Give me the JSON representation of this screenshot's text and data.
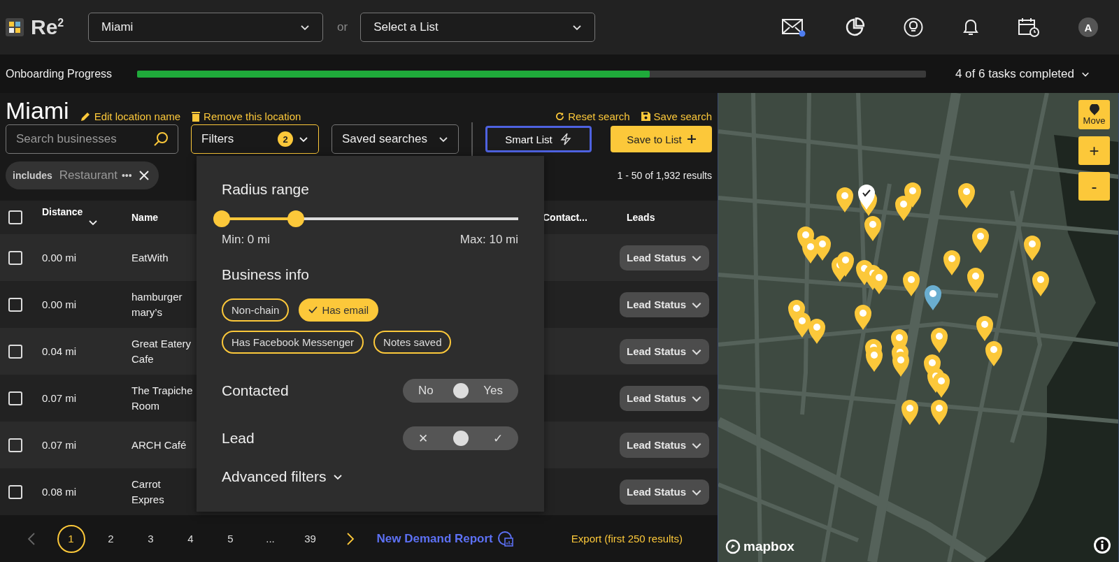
{
  "header": {
    "logo": "Re$^{2}$",
    "location_select": {
      "value": "Miami"
    },
    "separator": "or",
    "list_select": {
      "placeholder": "Select a List"
    },
    "mail_unread": true,
    "avatar": "A"
  },
  "onboarding": {
    "label": "Onboarding Progress",
    "level": 0.65,
    "summary": "4 of 6 tasks completed"
  },
  "location": {
    "title": "Miami",
    "actions": [
      {
        "kind": "edit",
        "label": "Edit location name"
      },
      {
        "kind": "remove",
        "label": "Remove this location"
      }
    ],
    "search_actions": [
      {
        "kind": "reset",
        "label": "Reset search"
      },
      {
        "kind": "save",
        "label": "Save search"
      }
    ]
  },
  "search": {
    "placeholder": "Search businesses"
  },
  "filters_button": {
    "label": "Filters",
    "count": "2",
    "expanded": true
  },
  "saved_searches": {
    "label": "Saved searches"
  },
  "smart_list_button": {
    "label": "Smart List"
  },
  "save_to_list_button": {
    "label": "Save to List"
  },
  "chips": [
    {
      "prefix": "includes",
      "value": "Restaurant",
      "more": "•••"
    }
  ],
  "results_count": "1 - 50 of 1,932 results",
  "table": {
    "all_selected": false,
    "columns": [
      {
        "label": "Distance",
        "sorted": true
      },
      {
        "label": "Name"
      },
      {
        "label": "Contact..."
      },
      {
        "label": "Leads"
      }
    ],
    "rows": [
      {
        "selected": false,
        "distance": "0.00 mi",
        "name": "EatWith",
        "lead_status": "Lead Status"
      },
      {
        "selected": false,
        "distance": "0.00 mi",
        "name": "hamburger mary’s",
        "lead_status": "Lead Status"
      },
      {
        "selected": false,
        "distance": "0.04 mi",
        "name": "Great Eatery Cafe",
        "lead_status": "Lead Status"
      },
      {
        "selected": false,
        "distance": "0.07 mi",
        "name": "The Trapiche Room",
        "lead_status": "Lead Status"
      },
      {
        "selected": false,
        "distance": "0.07 mi",
        "name": "ARCH Café",
        "lead_status": "Lead Status"
      },
      {
        "selected": false,
        "distance": "0.08 mi",
        "name": "Carrot Expres",
        "lead_status": "Lead Status"
      }
    ]
  },
  "pagination": {
    "pages": [
      {
        "label": "1",
        "selected": true
      },
      {
        "label": "2",
        "selected": false
      },
      {
        "label": "3",
        "selected": false
      },
      {
        "label": "4",
        "selected": false
      },
      {
        "label": "5",
        "selected": false
      },
      {
        "label": "...",
        "selected": false
      },
      {
        "label": "39",
        "selected": false
      }
    ],
    "prev_disabled": true
  },
  "new_demand_report": "New Demand Report",
  "export": "Export (first 250 results)",
  "filter_panel": {
    "radius": {
      "title": "Radius range",
      "thumbs": [
        {
          "level": 0
        },
        {
          "level": 0.25
        }
      ],
      "min_label": "Min: 0 mi",
      "max_label": "Max: 10 mi"
    },
    "business_info": {
      "title": "Business info",
      "tags": [
        {
          "label": "Non-chain",
          "selected": false
        },
        {
          "label": "Has email",
          "selected": true
        },
        {
          "label": "Has Facebook Messenger",
          "selected": false
        },
        {
          "label": "Notes saved",
          "selected": false
        }
      ]
    },
    "toggles": [
      {
        "label": "Contacted",
        "options": [
          {
            "label": "No",
            "selected": false
          },
          {
            "label": "Yes",
            "selected": false
          }
        ]
      },
      {
        "label": "Lead",
        "options": [
          {
            "label": "✕",
            "selected": false
          },
          {
            "label": "✓",
            "selected": false
          }
        ]
      }
    ],
    "advanced_filters": {
      "label": "Advanced filters",
      "expanded": false
    }
  },
  "map": {
    "controls": [
      {
        "kind": "move",
        "label": "Move"
      },
      {
        "kind": "zoom_in",
        "label": "+"
      },
      {
        "kind": "zoom_out",
        "label": "-"
      }
    ],
    "attribution": "mapbox"
  }
}
